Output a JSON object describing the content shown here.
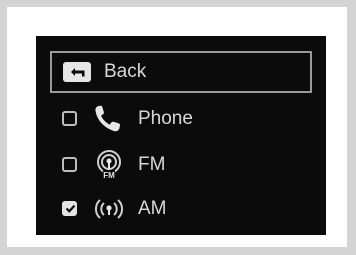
{
  "menu": {
    "back": {
      "label": "Back",
      "icon": "back-arrow-icon"
    },
    "items": [
      {
        "label": "Phone",
        "icon": "phone-icon",
        "checked": false
      },
      {
        "label": "FM",
        "icon": "fm-radio-icon",
        "icon_badge": "FM",
        "checked": false
      },
      {
        "label": "AM",
        "icon": "am-radio-icon",
        "checked": true
      }
    ]
  },
  "colors": {
    "screen": "#0b0b0b",
    "text": "#d8d8d8",
    "highlight_border": "#9a9a9a",
    "outer_background": "#d4d4d4"
  }
}
